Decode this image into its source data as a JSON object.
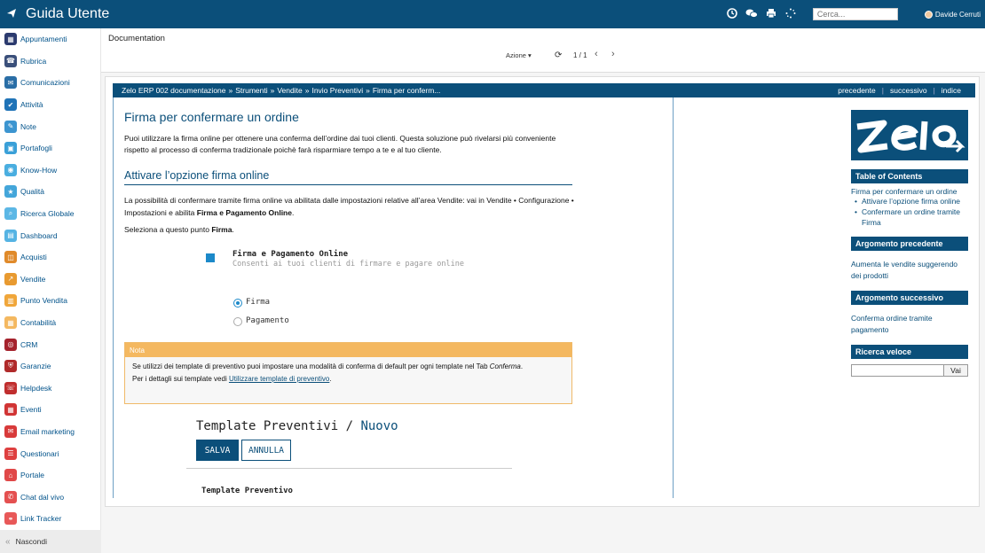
{
  "app": {
    "title": "Guida Utente"
  },
  "topbar": {
    "search_placeholder": "Cerca...",
    "user_name": "Davide Cerruti",
    "icons": [
      "activity-icon",
      "chat-icon",
      "print-icon",
      "loading-icon"
    ]
  },
  "sidebar": {
    "items": [
      {
        "label": "Appuntamenti",
        "icon": "calendar-icon",
        "color": "#2b3a6e",
        "glyph": "▦"
      },
      {
        "label": "Rubrica",
        "icon": "contacts-icon",
        "color": "#3a4f7a",
        "glyph": "☎"
      },
      {
        "label": "Comunicazioni",
        "icon": "message-icon",
        "color": "#2a6ea6",
        "glyph": "✉"
      },
      {
        "label": "Attività",
        "icon": "tasks-icon",
        "color": "#1f73b7",
        "glyph": "✔"
      },
      {
        "label": "Note",
        "icon": "note-icon",
        "color": "#3c95d0",
        "glyph": "✎"
      },
      {
        "label": "Portafogli",
        "icon": "folder-icon",
        "color": "#3aa0d8",
        "glyph": "▣"
      },
      {
        "label": "Know-How",
        "icon": "brain-icon",
        "color": "#4aaee0",
        "glyph": "◉"
      },
      {
        "label": "Qualità",
        "icon": "quality-icon",
        "color": "#44a6da",
        "glyph": "★"
      },
      {
        "label": "Ricerca Globale",
        "icon": "search-icon",
        "color": "#5cb7e5",
        "glyph": "⌕"
      },
      {
        "label": "Dashboard",
        "icon": "dashboard-icon",
        "color": "#55b3e3",
        "glyph": "▤"
      },
      {
        "label": "Acquisti",
        "icon": "cart-icon",
        "color": "#e08a2a",
        "glyph": "◫"
      },
      {
        "label": "Vendite",
        "icon": "sales-icon",
        "color": "#e89a30",
        "glyph": "↗"
      },
      {
        "label": "Punto Vendita",
        "icon": "pos-icon",
        "color": "#f0a63a",
        "glyph": "▥"
      },
      {
        "label": "Contabilità",
        "icon": "accounting-icon",
        "color": "#f4b860",
        "glyph": "▦"
      },
      {
        "label": "CRM",
        "icon": "crm-icon",
        "color": "#a5222c",
        "glyph": "◎"
      },
      {
        "label": "Garanzie",
        "icon": "warranty-icon",
        "color": "#b02a2a",
        "glyph": "⛨"
      },
      {
        "label": "Helpdesk",
        "icon": "helpdesk-icon",
        "color": "#c02e2e",
        "glyph": "☏"
      },
      {
        "label": "Eventi",
        "icon": "events-icon",
        "color": "#d13434",
        "glyph": "▦"
      },
      {
        "label": "Email marketing",
        "icon": "email-icon",
        "color": "#d83a3a",
        "glyph": "✉"
      },
      {
        "label": "Questionari",
        "icon": "survey-icon",
        "color": "#de4040",
        "glyph": "☰"
      },
      {
        "label": "Portale",
        "icon": "portal-icon",
        "color": "#e04848",
        "glyph": "⌂"
      },
      {
        "label": "Chat dal vivo",
        "icon": "livechat-icon",
        "color": "#e45050",
        "glyph": "✆"
      },
      {
        "label": "Link Tracker",
        "icon": "link-icon",
        "color": "#e85858",
        "glyph": "⚭"
      }
    ],
    "hide_label": "Nascondi"
  },
  "control": {
    "breadcrumb": "Documentation",
    "action_label": "Azione ▾",
    "pager": "1 / 1"
  },
  "docnav": {
    "crumbs": [
      "Zelo ERP 002 documentazione",
      "»",
      "Strumenti",
      "»",
      "Vendite",
      "»",
      "Invio Preventivi",
      "»",
      "Firma per conferm..."
    ],
    "prev": "precedente",
    "next": "successivo",
    "index": "indice"
  },
  "article": {
    "title": "Firma per confermare un ordine",
    "intro": "Puoi utilizzare la firma online per ottenere una conferma dell’ordine dai tuoi clienti. Questa soluzione può rivelarsi più conveniente rispetto al processo di conferma tradizionale poichè farà risparmiare tempo a te e al tuo cliente.",
    "section_title": "Attivare l’opzione firma online",
    "p2_a": "La possibilità di confermare tramite firma online va abilitata dalle impostazioni relative all’area Vendite: vai in Vendite • Configurazione • Impostazioni e abilita ",
    "p2_b": "Firma e Pagamento Online",
    "p3_a": "Seleziona a questo punto ",
    "p3_b": "Firma",
    "setting": {
      "title": "Firma e Pagamento Online",
      "subtitle": "Consenti ai tuoi clienti di firmare e pagare online",
      "options": [
        "Firma",
        "Pagamento"
      ],
      "selected": "Firma"
    },
    "note": {
      "header": "Nota",
      "line1_a": "Se utilizzi dei template di preventivo puoi impostare una modalità di conferma di default per ogni template nel Tab ",
      "line1_b": "Conferma",
      "line2_a": "Per i dettagli sui template vedi ",
      "link": "Utilizzare template di preventivo",
      "line2_b": "."
    },
    "template": {
      "title": "Template Preventivi /",
      "new": "Nuovo",
      "save": "SALVA",
      "cancel": "ANNULLA",
      "field": "Template Preventivo"
    }
  },
  "rail": {
    "toc_header": "Table of Contents",
    "toc_main": "Firma per confermare un ordine",
    "toc_items": [
      "Attivare l’opzione firma online",
      "Confermare un ordine tramite Firma"
    ],
    "prev_header": "Argomento precedente",
    "prev_link": "Aumenta le vendite suggerendo dei prodotti",
    "next_header": "Argomento successivo",
    "next_link": "Conferma ordine tramite pagamento",
    "search_header": "Ricerca veloce",
    "search_button": "Vai"
  }
}
